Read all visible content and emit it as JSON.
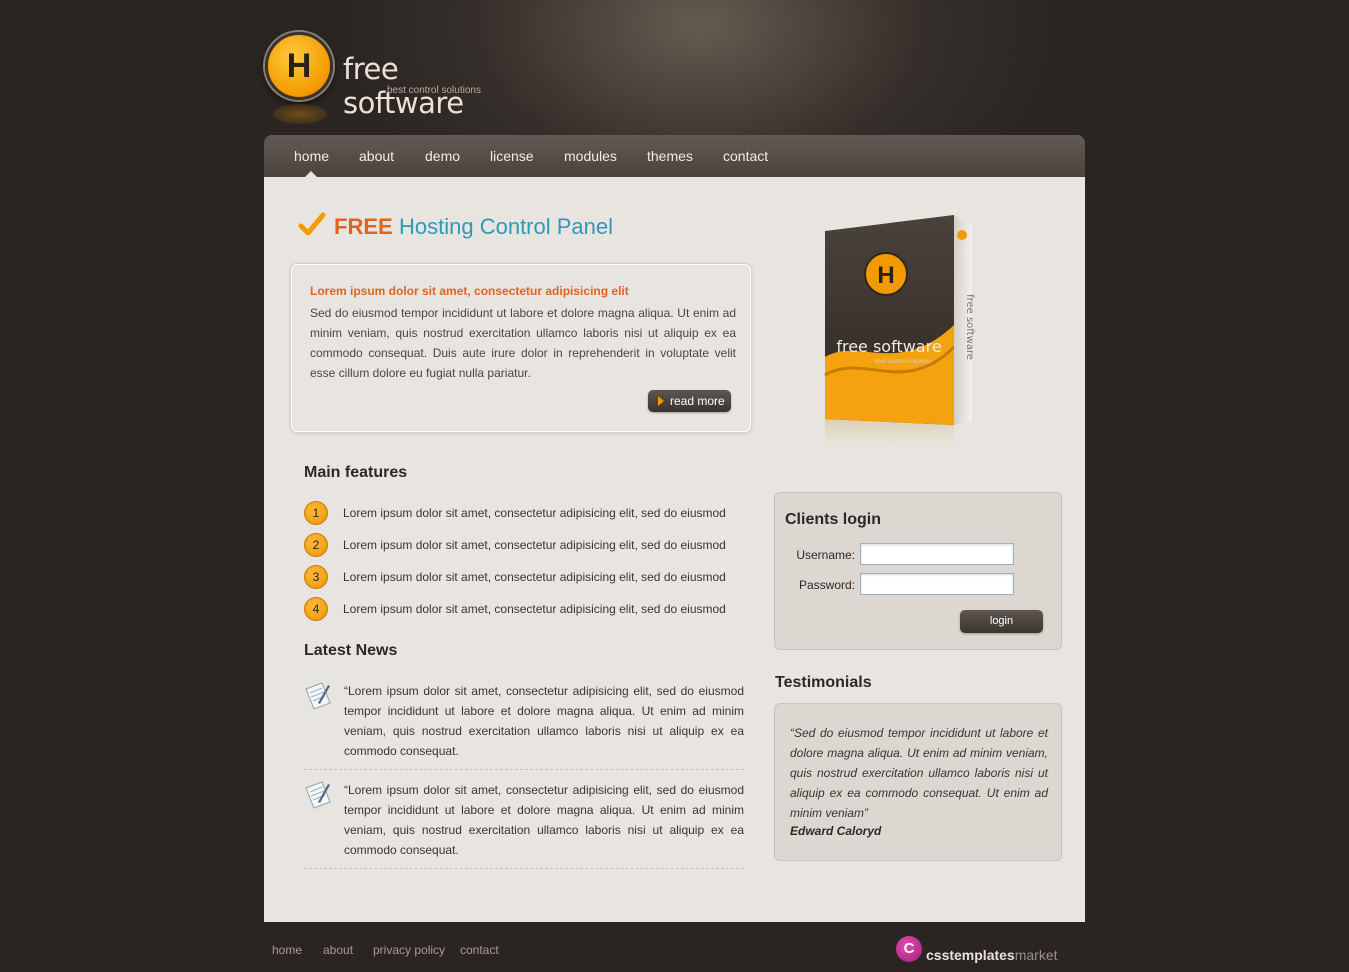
{
  "header": {
    "logo_letter": "H",
    "logo_title": "free software",
    "logo_subtitle": "best control solutions"
  },
  "nav": {
    "items": [
      "home",
      "about",
      "demo",
      "license",
      "modules",
      "themes",
      "contact"
    ],
    "active": "home"
  },
  "headline": {
    "free": "FREE",
    "rest": "Hosting Control Panel"
  },
  "intro": {
    "title": "Lorem ipsum dolor sit amet, consectetur adipisicing elit",
    "text": "Sed do eiusmod tempor incididunt ut labore et dolore magna aliqua. Ut enim ad minim veniam, quis nostrud exercitation ullamco laboris nisi ut aliquip ex ea commodo consequat. Duis aute irure dolor in reprehenderit in voluptate velit esse cillum dolore eu fugiat nulla pariatur.",
    "read_more": "read more"
  },
  "product": {
    "letter": "H",
    "title": "free software",
    "subtitle": "best control solutions",
    "side": "free software"
  },
  "features": {
    "title": "Main features",
    "items": [
      {
        "num": "1",
        "text": "Lorem ipsum dolor sit amet, consectetur adipisicing elit, sed do eiusmod"
      },
      {
        "num": "2",
        "text": "Lorem ipsum dolor sit amet, consectetur adipisicing elit, sed do eiusmod"
      },
      {
        "num": "3",
        "text": "Lorem ipsum dolor sit amet, consectetur adipisicing elit, sed do eiusmod"
      },
      {
        "num": "4",
        "text": "Lorem ipsum dolor sit amet, consectetur adipisicing elit, sed do eiusmod"
      }
    ]
  },
  "news": {
    "title": "Latest News",
    "items": [
      {
        "text": "“Lorem ipsum dolor sit amet, consectetur adipisicing elit, sed do eiusmod tempor incididunt ut labore et dolore magna aliqua. Ut enim ad minim veniam, quis nostrud exercitation ullamco laboris nisi ut aliquip ex ea commodo consequat."
      },
      {
        "text": "“Lorem ipsum dolor sit amet, consectetur adipisicing elit, sed do eiusmod tempor incididunt ut labore et dolore magna aliqua. Ut enim ad minim veniam, quis nostrud exercitation ullamco laboris nisi ut aliquip ex ea commodo consequat."
      }
    ]
  },
  "login": {
    "title": "Clients login",
    "username_label": "Username:",
    "password_label": "Password:",
    "username_value": "",
    "password_value": "",
    "button": "login"
  },
  "testimonials": {
    "title": "Testimonials",
    "quote": "“Sed do eiusmod tempor incididunt ut labore et dolore magna aliqua. Ut enim ad minim veniam, quis nostrud exercitation ullamco laboris nisi ut aliquip ex ea commodo consequat. Ut enim ad minim veniam”",
    "author": "Edward Caloryd"
  },
  "footer": {
    "links": [
      "home",
      "about",
      "privacy policy",
      "contact"
    ],
    "brand_letter": "C",
    "brand_bold": "csstemplates",
    "brand_light": "market"
  },
  "colors": {
    "accent_orange": "#e0641f",
    "accent_blue": "#2a9cb8",
    "logo_yellow": "#f29a00",
    "background": "#2a2522",
    "content": "#e8e5e0"
  }
}
